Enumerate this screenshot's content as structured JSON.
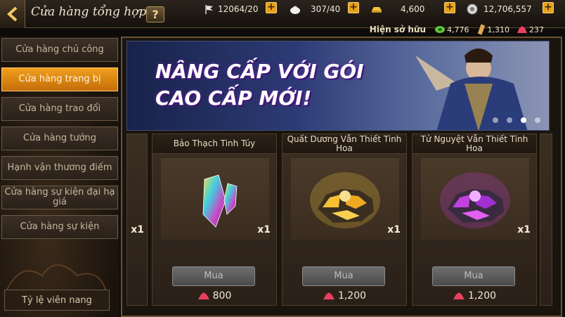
{
  "header": {
    "title": "Cửa hàng tổng hợp",
    "help_label": "?",
    "resources": [
      {
        "name": "flag-icon",
        "value": "12064/20"
      },
      {
        "name": "bun-icon",
        "value": "307/40"
      },
      {
        "name": "gold-ingot-icon",
        "value": "4,600"
      },
      {
        "name": "silver-coin-icon",
        "value": "12,706,557"
      }
    ],
    "plus_label": "+"
  },
  "owned": {
    "label": "Hiện sở hữu",
    "items": [
      {
        "name": "green-jade-icon",
        "value": "4,776",
        "color": "#5fc43a"
      },
      {
        "name": "scroll-icon",
        "value": "1,310",
        "color": "#e0a852"
      },
      {
        "name": "red-gem-icon",
        "value": "237",
        "color": "#e94060"
      }
    ]
  },
  "sidebar": {
    "items": [
      {
        "label": "Cửa hàng chủ công",
        "active": false
      },
      {
        "label": "Cửa hàng trang bị",
        "active": true
      },
      {
        "label": "Cửa hàng trao đổi",
        "active": false
      },
      {
        "label": "Cửa hàng tướng",
        "active": false
      },
      {
        "label": "Hạnh vận thương điếm",
        "active": false
      },
      {
        "label": "Cửa hàng sự kiện đại hạ giá",
        "active": false
      },
      {
        "label": "Cửa hàng sự kiện",
        "active": false
      }
    ],
    "rate_label": "Tỷ lệ viên nang"
  },
  "banner": {
    "line1": "NÂNG CẤP VỚI GÓI",
    "line2": "CAO CẤP MỚI!",
    "dots": 4,
    "active_dot": 3
  },
  "shop": {
    "partial_qty": "x1",
    "cards": [
      {
        "name": "Bảo Thạch Tinh Túy",
        "qty": "x1",
        "buy_label": "Mua",
        "price": "800",
        "gem": "crystal"
      },
      {
        "name": "Quất Dương Vẫn Thiết Tinh Hoa",
        "qty": "x1",
        "buy_label": "Mua",
        "price": "1,200",
        "gem": "gold-ore"
      },
      {
        "name": "Tử Nguyệt Vẫn Thiết Tinh Hoa",
        "qty": "x1",
        "buy_label": "Mua",
        "price": "1,200",
        "gem": "purple-ore"
      }
    ]
  },
  "colors": {
    "accent": "#e8a11c",
    "active_tab": "#f0a020"
  }
}
